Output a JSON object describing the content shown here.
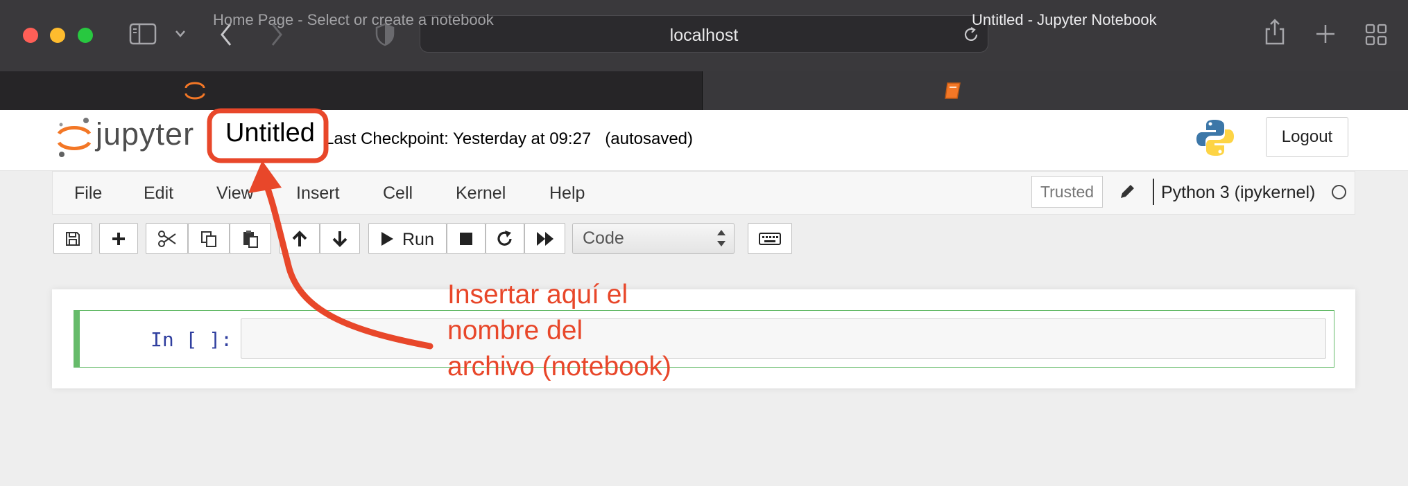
{
  "browser": {
    "url": "localhost",
    "tabs": [
      {
        "label": "Home Page - Select or create a notebook",
        "active": false
      },
      {
        "label": "Untitled - Jupyter Notebook",
        "active": true
      }
    ]
  },
  "header": {
    "logo_text": "jupyter",
    "notebook_name": "Untitled",
    "checkpoint": "Last Checkpoint: Yesterday at 09:27   (autosaved)",
    "logout_label": "Logout"
  },
  "menu": {
    "items": [
      "File",
      "Edit",
      "View",
      "Insert",
      "Cell",
      "Kernel",
      "Help"
    ],
    "trusted_label": "Trusted",
    "kernel_name": "Python 3 (ipykernel)"
  },
  "toolbar": {
    "run_label": "Run",
    "cell_type": "Code"
  },
  "cell": {
    "prompt": "In [ ]:"
  },
  "annotation": {
    "text": "Insertar aquí el nombre del archivo (notebook)",
    "color": "#e8472a"
  },
  "colors": {
    "chrome_bg": "#3a393c",
    "cell_selected_border": "#66bb6a",
    "jupyter_orange": "#f37726"
  }
}
